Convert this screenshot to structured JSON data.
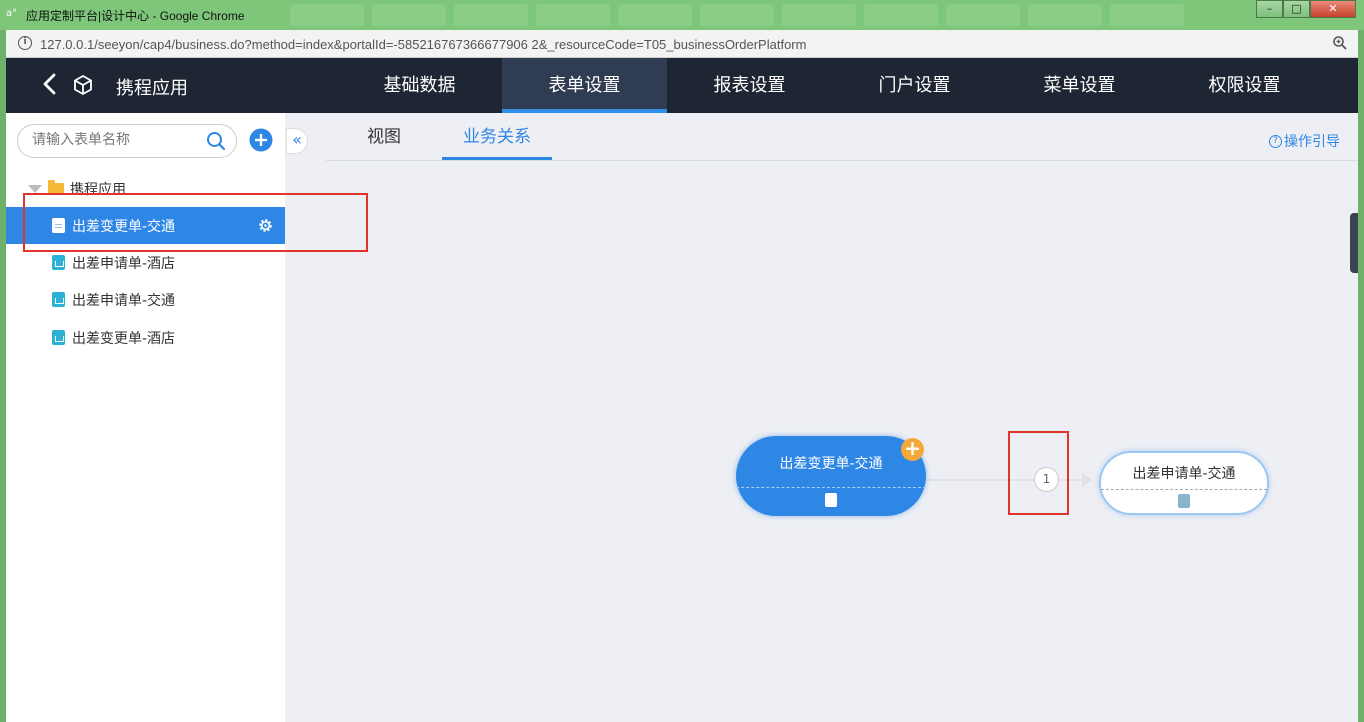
{
  "window": {
    "title": "应用定制平台|设计中心 - Google Chrome",
    "favicon": "a°",
    "url": "127.0.0.1/seeyon/cap4/business.do?method=index&portalId=-585216767366677906 2&_resourceCode=T05_businessOrderPlatform"
  },
  "header": {
    "app_title": "携程应用",
    "nav": [
      {
        "label": "基础数据"
      },
      {
        "label": "表单设置"
      },
      {
        "label": "报表设置"
      },
      {
        "label": "门户设置"
      },
      {
        "label": "菜单设置"
      },
      {
        "label": "权限设置"
      }
    ],
    "active_nav": "表单设置"
  },
  "sidebar": {
    "search_placeholder": "请输入表单名称",
    "root": "携程应用",
    "items": [
      {
        "label": "出差变更单-交通",
        "active": true
      },
      {
        "label": "出差申请单-酒店"
      },
      {
        "label": "出差申请单-交通"
      },
      {
        "label": "出差变更单-酒店"
      }
    ]
  },
  "content": {
    "tabs": [
      {
        "label": "视图"
      },
      {
        "label": "业务关系"
      }
    ],
    "active_tab": "业务关系",
    "guide_label": "操作引导"
  },
  "relation": {
    "source": "出差变更单-交通",
    "target": "出差申请单-交通",
    "count": "1"
  },
  "colors": {
    "accent": "#2e86e5",
    "nav_bg": "#1e2533",
    "highlight": "#e0342c",
    "plus": "#f4a83a"
  }
}
